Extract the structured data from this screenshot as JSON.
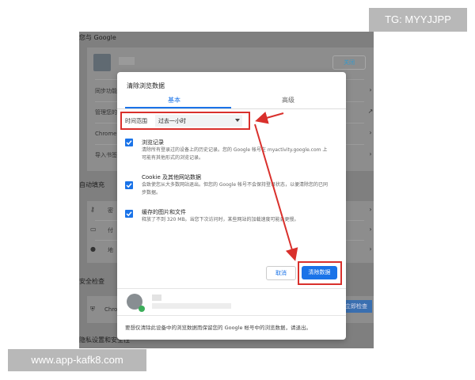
{
  "watermarks": {
    "top": "TG: MYYJJPP",
    "bottom": "www.app-kafk8.com"
  },
  "background": {
    "heading": "您与 Google",
    "close_button": "关闭",
    "rows": [
      "同步功能和",
      "管理您的 G",
      "Chrome 名",
      "导入书签和"
    ],
    "autofill_section": "自动填充",
    "autofill_rows": [
      "密",
      "付",
      "地"
    ],
    "safety_section": "安全检查",
    "safety_row": "Chro",
    "check_button": "立即检查",
    "privacy_section": "隐私设置和安全性"
  },
  "dialog": {
    "title": "清除浏览数据",
    "tabs": {
      "basic": "基本",
      "advanced": "高级"
    },
    "time_range": {
      "label": "时间范围",
      "value": "过去一小时"
    },
    "items": [
      {
        "title": "浏览记录",
        "desc": "清除所有登录过的设备上的历史记录。您的 Google 帐号在 myactivity.google.com 上可能有其他形式的浏览记录。",
        "checked": true
      },
      {
        "title": "Cookie 及其他网站数据",
        "desc": "会致使您从大多数网站退出。但您的 Google 帐号不会保持登录状态，以便清除您的已同步数据。",
        "checked": true
      },
      {
        "title": "缓存的图片和文件",
        "desc": "释放了不到 320 MB。当您下次访问时，某些网站的加载速度可能会更慢。",
        "checked": true
      }
    ],
    "cancel_label": "取消",
    "clear_label": "清除数据",
    "footer": "要想仅清除此设备中的浏览数据而保留您的 Google 帐号中的浏览数据，请退出。"
  },
  "colors": {
    "accent": "#1a73e8",
    "highlight": "#d9302c"
  }
}
